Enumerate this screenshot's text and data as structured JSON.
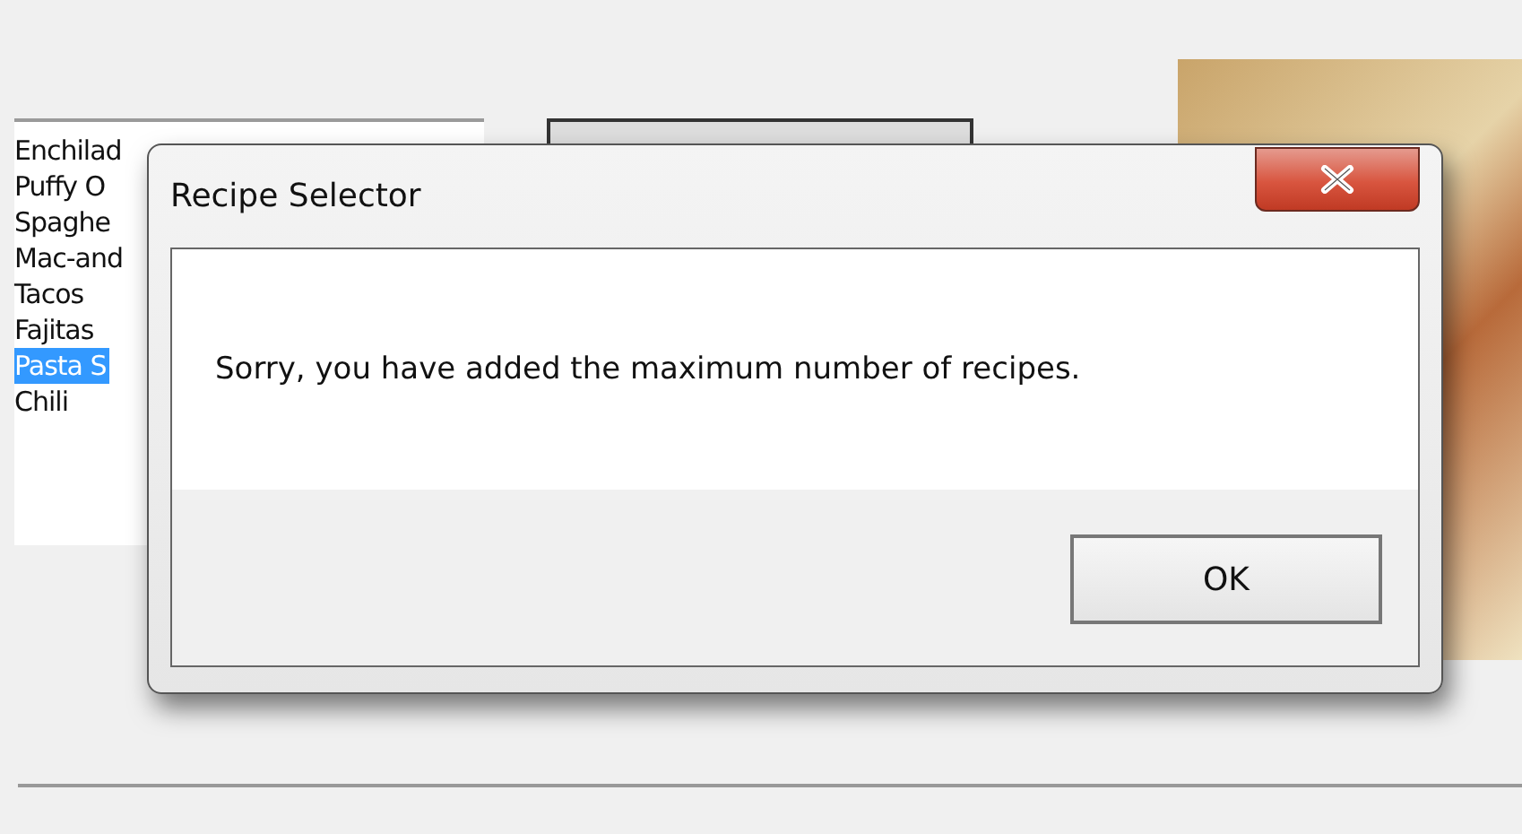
{
  "recipe_list": {
    "items": [
      {
        "label": "Enchilad",
        "selected": false
      },
      {
        "label": "Puffy O",
        "selected": false
      },
      {
        "label": "Spaghe",
        "selected": false
      },
      {
        "label": "Mac-and",
        "selected": false
      },
      {
        "label": "Tacos",
        "selected": false
      },
      {
        "label": "Fajitas",
        "selected": false
      },
      {
        "label": "Pasta S",
        "selected": true
      },
      {
        "label": "Chili",
        "selected": false
      }
    ]
  },
  "dialog": {
    "title": "Recipe Selector",
    "message": "Sorry, you have added the maximum number of recipes.",
    "buttons": [
      "OK"
    ]
  }
}
